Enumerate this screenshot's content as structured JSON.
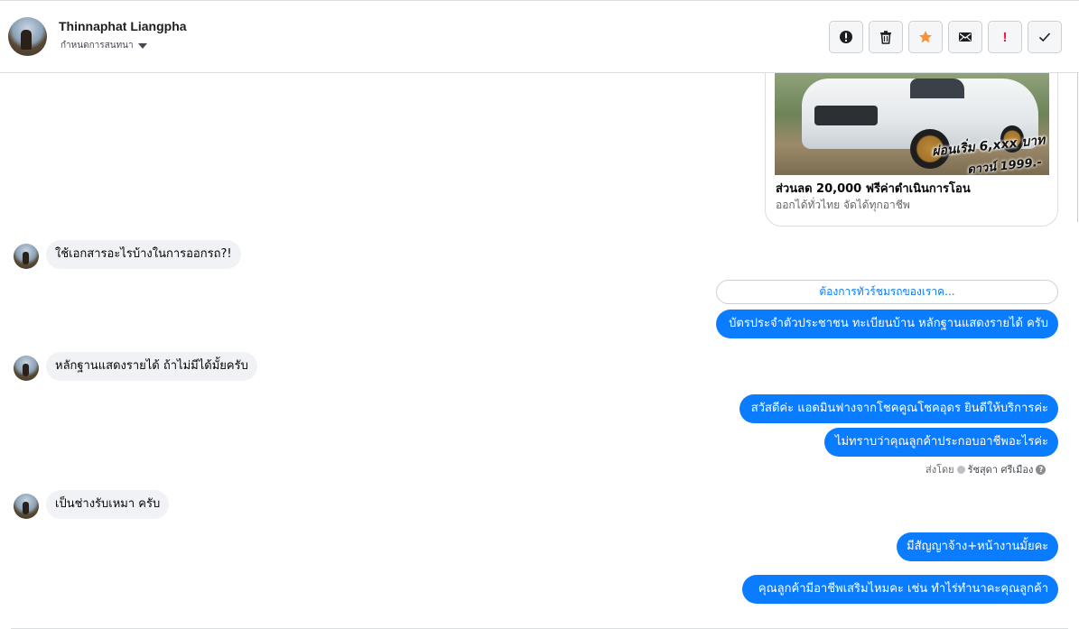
{
  "header": {
    "contact_name": "Thinnaphat Liangpha",
    "contact_sub": "กำหนดการสนทนา",
    "actions": [
      {
        "name": "report-icon",
        "color": "#1c1e21"
      },
      {
        "name": "trash-icon",
        "color": "#1c1e21"
      },
      {
        "name": "star-icon",
        "color": "#f7923a"
      },
      {
        "name": "mail-icon",
        "color": "#1c1e21"
      },
      {
        "name": "urgent-icon",
        "color": "#e41e3f"
      },
      {
        "name": "check-icon",
        "color": "#1c1e21"
      }
    ],
    "urgent_glyph": "!"
  },
  "card": {
    "promo_line1": "ผ่อนเริ่ม 6,xxx บาท",
    "promo_line2": "ดาวน์ 1999.-",
    "title": "ส่วนลด 20,000 ฟรีค่าดำเนินการโอน",
    "subtitle": "ออกได้ทั่วไทย จัดได้ทุกอาชีพ"
  },
  "messages": {
    "in_1": "ใช้เอกสารอะไรบ้างในการออกรถ?!",
    "quick_reply": "ต้องการทัวร์ชมรถของเราค...",
    "out_1": "บัตรประจำตัวประชาชน ทะเบียนบ้าน หลักฐานแสดงรายได้ ครับ",
    "in_2": "หลักฐานแสดงรายได้ ถ้าไม่มีได้มั้ยครับ",
    "out_2": "สวัสดีค่ะ แอดมินฟางจากโชคคูณโชคอุดร ยินดีให้บริการค่ะ",
    "out_3": "ไม่ทราบว่าคุณลูกค้าประกอบอาชีพอะไรค่ะ",
    "sent_by_label": "ส่งโดย",
    "sent_by_name": "รัชสุดา ศรีเมือง",
    "in_3": "เป็นช่างรับเหมา ครับ",
    "out_4": "มีสัญญาจ้าง+หน้างานมั้ยคะ",
    "out_5": "คุณลูกค้ามีอาชีพเสริมไหมคะ  เช่น ทำไร่ทำนาคะคุณลูกค้า"
  },
  "colors": {
    "outgoing_bubble": "#0a7cff",
    "incoming_bubble": "#f0f2f5",
    "quick_reply_text": "#0a7cff"
  }
}
